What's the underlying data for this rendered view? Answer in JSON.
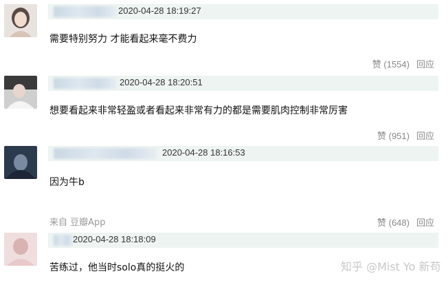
{
  "comments": [
    {
      "timestamp": "2020-04-28 18:19:27",
      "text": "需要特别努力 才能看起来毫不费力",
      "likes": "赞 (1554)",
      "reply": "回应"
    },
    {
      "timestamp": "2020-04-28 18:20:51",
      "text": "想要看起来非常轻盈或者看起来非常有力的都是需要肌肉控制非常厉害",
      "likes": "赞 (951)",
      "reply": "回应"
    },
    {
      "timestamp": "2020-04-28 18:16:53",
      "text": "因为牛b",
      "source": "来自 豆瓣App",
      "likes": "赞 (648)",
      "reply": "回应"
    },
    {
      "timestamp": "2020-04-28 18:18:09",
      "text": "苦练过，他当时solo真的挺火的"
    }
  ],
  "watermark": "知乎 @Mist Yo 新苟"
}
